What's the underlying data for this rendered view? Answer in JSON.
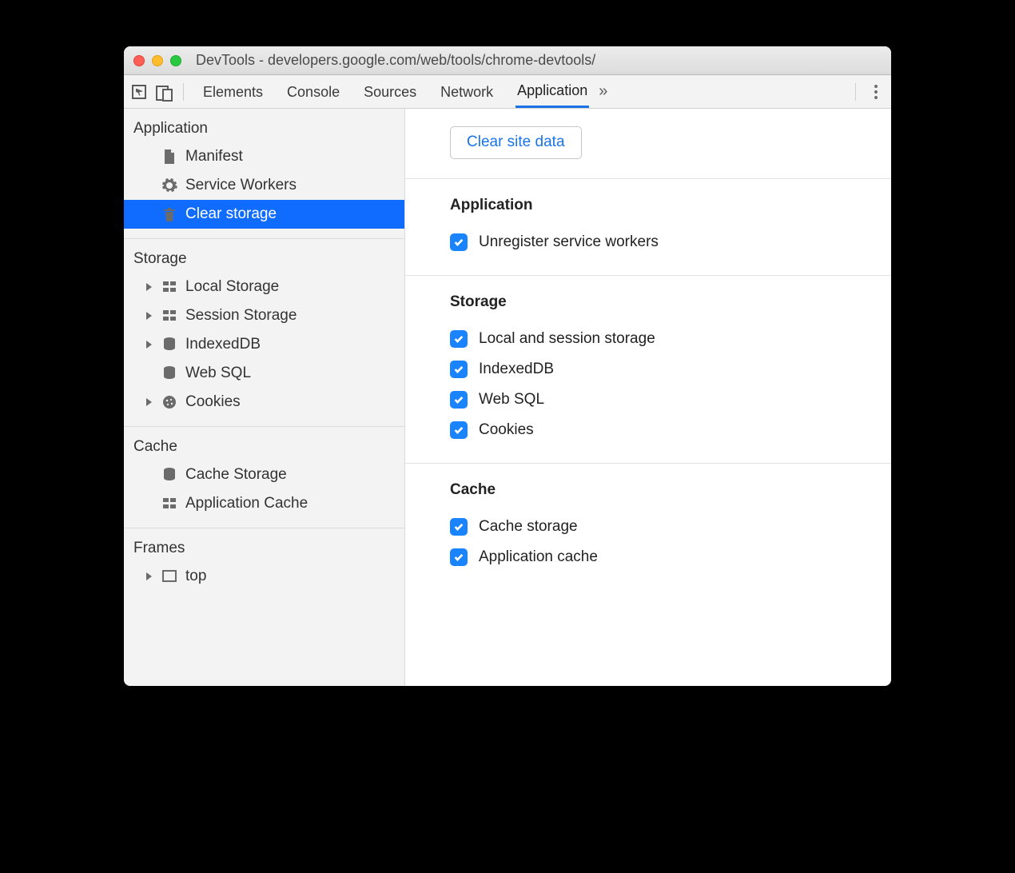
{
  "window": {
    "title": "DevTools - developers.google.com/web/tools/chrome-devtools/"
  },
  "toolbar": {
    "tabs": [
      "Elements",
      "Console",
      "Sources",
      "Network",
      "Application"
    ],
    "active": "Application",
    "overflow_glyph": "»"
  },
  "sidebar": {
    "groups": [
      {
        "title": "Application",
        "items": [
          {
            "label": "Manifest",
            "icon": "file-icon",
            "expandable": false
          },
          {
            "label": "Service Workers",
            "icon": "gear-icon",
            "expandable": false
          },
          {
            "label": "Clear storage",
            "icon": "trash-icon",
            "expandable": false,
            "selected": true
          }
        ]
      },
      {
        "title": "Storage",
        "items": [
          {
            "label": "Local Storage",
            "icon": "grid-icon",
            "expandable": true
          },
          {
            "label": "Session Storage",
            "icon": "grid-icon",
            "expandable": true
          },
          {
            "label": "IndexedDB",
            "icon": "database-icon",
            "expandable": true
          },
          {
            "label": "Web SQL",
            "icon": "database-icon",
            "expandable": false
          },
          {
            "label": "Cookies",
            "icon": "cookie-icon",
            "expandable": true
          }
        ]
      },
      {
        "title": "Cache",
        "items": [
          {
            "label": "Cache Storage",
            "icon": "database-icon",
            "expandable": false
          },
          {
            "label": "Application Cache",
            "icon": "grid-icon",
            "expandable": false
          }
        ]
      },
      {
        "title": "Frames",
        "items": [
          {
            "label": "top",
            "icon": "frame-icon",
            "expandable": true
          }
        ]
      }
    ]
  },
  "main": {
    "clear_button": "Clear site data",
    "sections": [
      {
        "heading": "Application",
        "checks": [
          {
            "label": "Unregister service workers",
            "checked": true
          }
        ]
      },
      {
        "heading": "Storage",
        "checks": [
          {
            "label": "Local and session storage",
            "checked": true
          },
          {
            "label": "IndexedDB",
            "checked": true
          },
          {
            "label": "Web SQL",
            "checked": true
          },
          {
            "label": "Cookies",
            "checked": true
          }
        ]
      },
      {
        "heading": "Cache",
        "checks": [
          {
            "label": "Cache storage",
            "checked": true
          },
          {
            "label": "Application cache",
            "checked": true
          }
        ]
      }
    ]
  }
}
